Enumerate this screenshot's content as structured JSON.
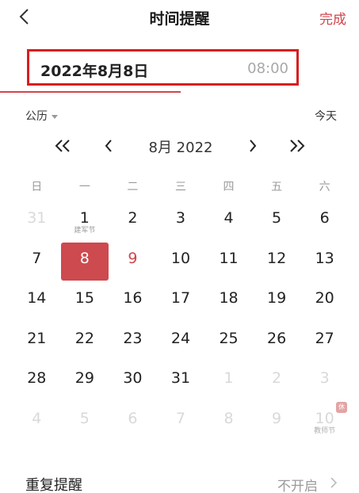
{
  "header": {
    "title": "时间提醒",
    "done_label": "完成"
  },
  "selected": {
    "date_text": "2022年8月8日",
    "time_text": "08:00"
  },
  "calendar": {
    "type_label": "公历",
    "today_label": "今天",
    "month_label": "8月  2022",
    "weekdays": [
      "日",
      "一",
      "二",
      "三",
      "四",
      "五",
      "六"
    ],
    "weeks": [
      [
        {
          "d": "31",
          "other": true
        },
        {
          "d": "1",
          "sub": "建军节"
        },
        {
          "d": "2"
        },
        {
          "d": "3"
        },
        {
          "d": "4"
        },
        {
          "d": "5"
        },
        {
          "d": "6"
        }
      ],
      [
        {
          "d": "7"
        },
        {
          "d": "8",
          "selected": true
        },
        {
          "d": "9",
          "today": true
        },
        {
          "d": "10"
        },
        {
          "d": "11"
        },
        {
          "d": "12"
        },
        {
          "d": "13"
        }
      ],
      [
        {
          "d": "14"
        },
        {
          "d": "15"
        },
        {
          "d": "16"
        },
        {
          "d": "17"
        },
        {
          "d": "18"
        },
        {
          "d": "19"
        },
        {
          "d": "20"
        }
      ],
      [
        {
          "d": "21"
        },
        {
          "d": "22"
        },
        {
          "d": "23"
        },
        {
          "d": "24"
        },
        {
          "d": "25"
        },
        {
          "d": "26"
        },
        {
          "d": "27"
        }
      ],
      [
        {
          "d": "28"
        },
        {
          "d": "29"
        },
        {
          "d": "30"
        },
        {
          "d": "31"
        },
        {
          "d": "1",
          "other": true
        },
        {
          "d": "2",
          "other": true
        },
        {
          "d": "3",
          "other": true
        }
      ],
      [
        {
          "d": "4",
          "other": true
        },
        {
          "d": "5",
          "other": true
        },
        {
          "d": "6",
          "other": true
        },
        {
          "d": "7",
          "other": true
        },
        {
          "d": "8",
          "other": true
        },
        {
          "d": "9",
          "other": true
        },
        {
          "d": "10",
          "other": true,
          "sub": "教师节",
          "badge": "休"
        }
      ]
    ]
  },
  "repeat": {
    "label": "重复提醒",
    "value": "不开启"
  },
  "colors": {
    "accent": "#d0454c",
    "highlight_border": "#d81e1e"
  }
}
